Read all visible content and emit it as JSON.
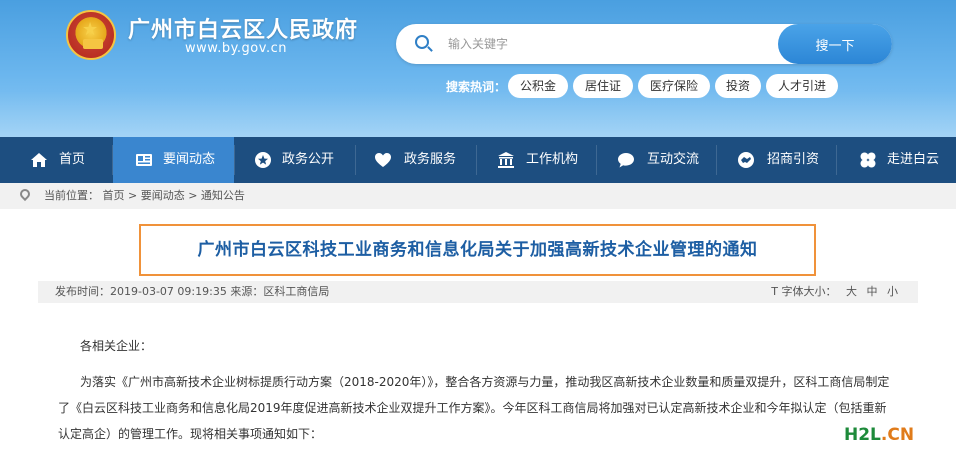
{
  "site": {
    "title": "广州市白云区人民政府",
    "url": "www.by.gov.cn",
    "emblem_icon": "national-emblem-icon"
  },
  "search": {
    "placeholder": "输入关键字",
    "button_label": "搜一下",
    "hot_label": "搜索热词：",
    "hot_tags": [
      "公积金",
      "居住证",
      "医疗保险",
      "投资",
      "人才引进"
    ]
  },
  "nav": {
    "items": [
      {
        "label": "首页",
        "icon": "home-icon"
      },
      {
        "label": "要闻动态",
        "icon": "news-icon",
        "active": true
      },
      {
        "label": "政务公开",
        "icon": "star-icon"
      },
      {
        "label": "政务服务",
        "icon": "heart-icon"
      },
      {
        "label": "工作机构",
        "icon": "building-icon"
      },
      {
        "label": "互动交流",
        "icon": "chat-icon"
      },
      {
        "label": "招商引资",
        "icon": "handshake-icon"
      },
      {
        "label": "走进白云",
        "icon": "clover-icon"
      }
    ]
  },
  "breadcrumb": {
    "text": "当前位置： 首页 > 要闻动态 > 通知公告"
  },
  "article": {
    "title": "广州市白云区科技工业商务和信息化局关于加强高新技术企业管理的通知",
    "meta_left": "发布时间：2019-03-07 09:19:35    来源：区科工商信局",
    "font_size_label": "T 字体大小：",
    "font_size_options": [
      "大",
      "中",
      "小"
    ],
    "greeting": "各相关企业：",
    "paragraph": "为落实《广州市高新技术企业树标提质行动方案（2018-2020年）》，整合各方资源与力量，推动我区高新技术企业数量和质量双提升，区科工商信局制定了《白云区科技工业商务和信息化局2019年度促进高新技术企业双提升工作方案》。今年区科工商信局将加强对已认定高新技术企业和今年拟认定（包括重新认定高企）的管理工作。现将相关事项通知如下："
  },
  "watermark": {
    "part1": "H2L",
    "part2": ".CN",
    "color1": "#1d8a3a",
    "color2": "#e07b1a"
  },
  "colors": {
    "header_blue": "#4a9fe0",
    "nav_bg": "#1d4e80",
    "nav_active": "#3a86cf",
    "title_blue": "#1d5ea3",
    "title_border": "#f0923a"
  }
}
